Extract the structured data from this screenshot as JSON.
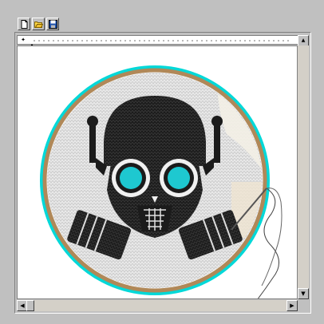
{
  "toolbar": {
    "buttons": [
      {
        "name": "new-file-button",
        "icon": "new-document-icon"
      },
      {
        "name": "open-file-button",
        "icon": "open-folder-icon"
      },
      {
        "name": "save-file-button",
        "icon": "save-disk-icon"
      }
    ]
  },
  "canvas": {
    "image": "cross-stitch-embroidery-hoop-gas-mask-skull",
    "colors": {
      "hoop_outer": "#00d8d8",
      "hoop_wood": "#b08858",
      "fabric": "#e8e8e8",
      "stitch_dark": "#1a1a1a",
      "eye_cyan": "#1ec8d0"
    }
  },
  "scrollbars": {
    "vertical": {
      "up_arrow": "▲",
      "down_arrow": "▼"
    },
    "horizontal": {
      "left_arrow": "◀",
      "right_arrow": "▶"
    }
  }
}
